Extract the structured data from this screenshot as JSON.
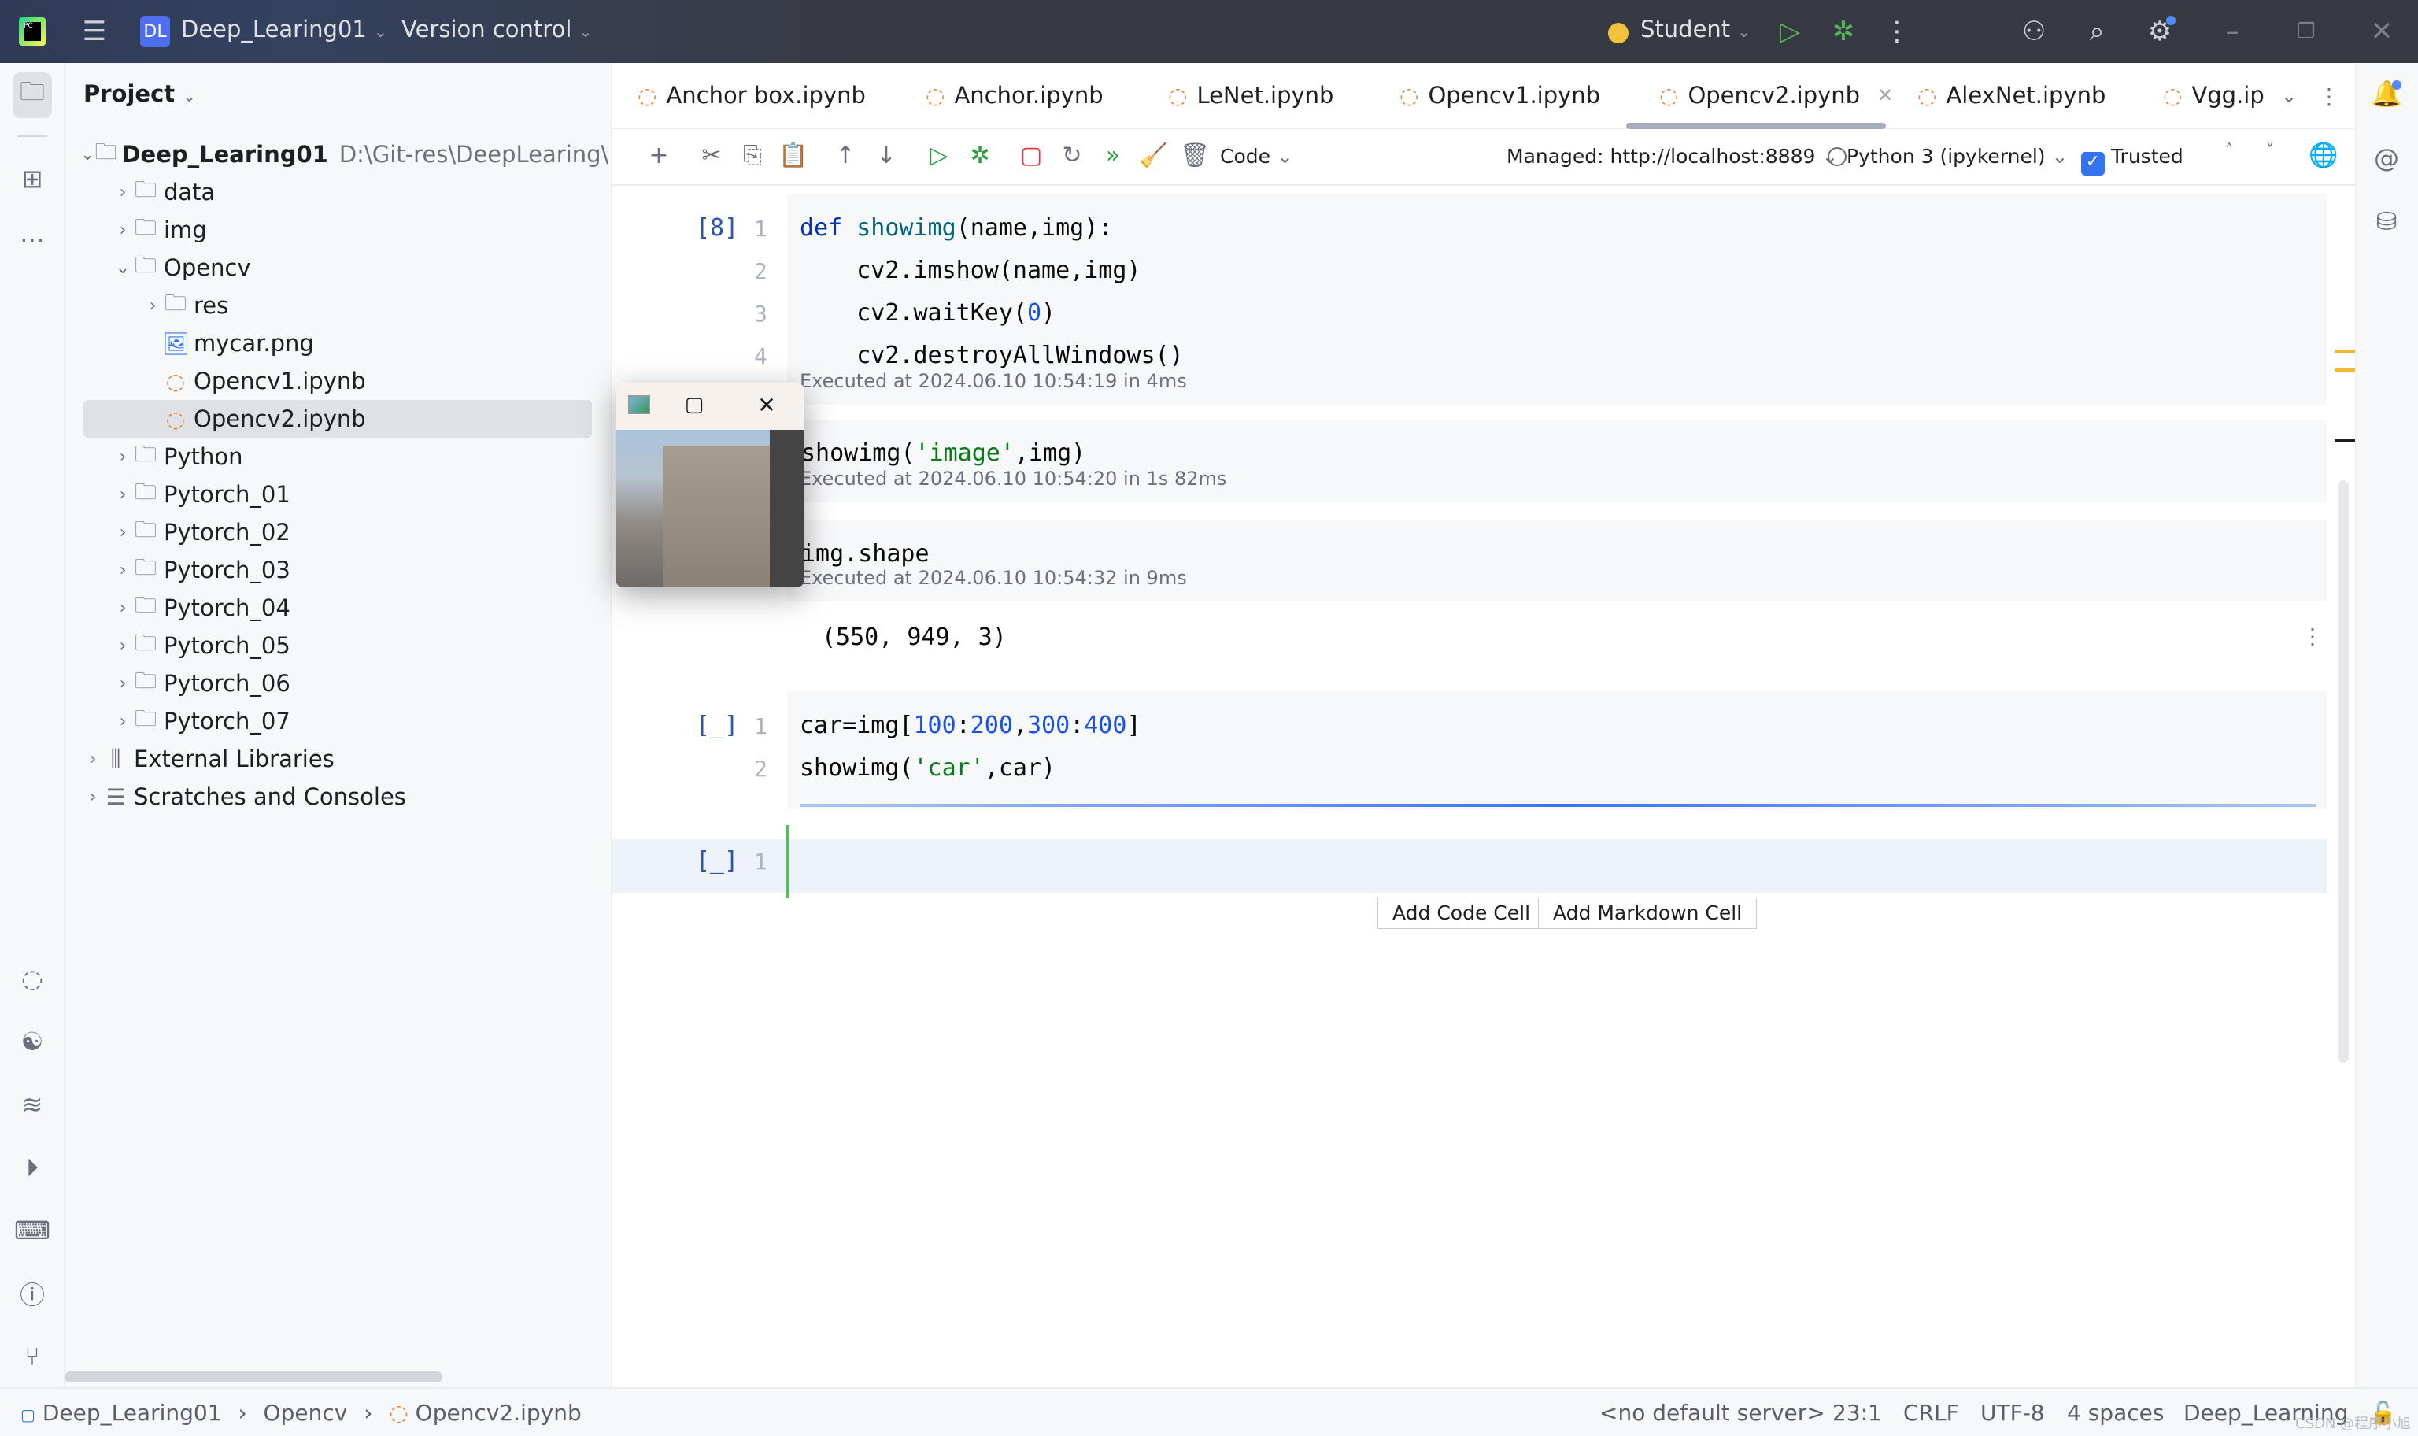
{
  "titlebar": {
    "project_badge": "DL",
    "project_name": "Deep_Learing01",
    "version_control": "Version control",
    "run_config": "Student"
  },
  "project_panel": {
    "title": "Project",
    "root": {
      "label": "Deep_Learing01",
      "path": "D:\\Git-res\\DeepLearing\\DL"
    },
    "items": [
      {
        "label": "data",
        "level": 1,
        "type": "folder",
        "expanded": false
      },
      {
        "label": "img",
        "level": 1,
        "type": "folder",
        "expanded": false
      },
      {
        "label": "Opencv",
        "level": 1,
        "type": "folder",
        "expanded": true
      },
      {
        "label": "res",
        "level": 2,
        "type": "folder",
        "expanded": false
      },
      {
        "label": "mycar.png",
        "level": 2,
        "type": "image"
      },
      {
        "label": "Opencv1.ipynb",
        "level": 2,
        "type": "notebook"
      },
      {
        "label": "Opencv2.ipynb",
        "level": 2,
        "type": "notebook",
        "selected": true
      },
      {
        "label": "Python",
        "level": 1,
        "type": "folder",
        "expanded": false
      },
      {
        "label": "Pytorch_01",
        "level": 1,
        "type": "folder",
        "expanded": false
      },
      {
        "label": "Pytorch_02",
        "level": 1,
        "type": "folder",
        "expanded": false
      },
      {
        "label": "Pytorch_03",
        "level": 1,
        "type": "folder",
        "expanded": false
      },
      {
        "label": "Pytorch_04",
        "level": 1,
        "type": "folder",
        "expanded": false
      },
      {
        "label": "Pytorch_05",
        "level": 1,
        "type": "folder",
        "expanded": false
      },
      {
        "label": "Pytorch_06",
        "level": 1,
        "type": "folder",
        "expanded": false
      },
      {
        "label": "Pytorch_07",
        "level": 1,
        "type": "folder",
        "expanded": false
      },
      {
        "label": "External Libraries",
        "level": 0,
        "type": "library",
        "expanded": false
      },
      {
        "label": "Scratches and Consoles",
        "level": 0,
        "type": "scratch",
        "expanded": false
      }
    ]
  },
  "tabs": [
    {
      "label": "Anchor box.ipynb"
    },
    {
      "label": "Anchor.ipynb"
    },
    {
      "label": "LeNet.ipynb"
    },
    {
      "label": "Opencv1.ipynb"
    },
    {
      "label": "Opencv2.ipynb",
      "active": true
    },
    {
      "label": "AlexNet.ipynb"
    },
    {
      "label": "Vgg.ip"
    }
  ],
  "toolbar": {
    "cell_type": "Code",
    "server": "Managed: http://localhost:8889",
    "kernel": "Python 3 (ipykernel)",
    "trusted_label": "Trusted",
    "trusted": true
  },
  "inspections": {
    "warnings": "2",
    "weak_warnings": "1"
  },
  "cells": [
    {
      "count": "[8]",
      "lines": [
        [
          {
            "t": "def ",
            "c": "kw"
          },
          {
            "t": "showimg",
            "c": "fn"
          },
          {
            "t": "(name,img):"
          }
        ],
        [
          {
            "t": "    cv2.imshow(name,img)"
          }
        ],
        [
          {
            "t": "    cv2.waitKey("
          },
          {
            "t": "0",
            "c": "num"
          },
          {
            "t": ")"
          }
        ],
        [
          {
            "t": "    cv2.destroyAllWindows()"
          }
        ]
      ],
      "executed": "Executed at 2024.06.10 10:54:19 in 4ms"
    },
    {
      "lines": [
        [
          {
            "t": "showimg("
          },
          {
            "t": "'image'",
            "c": "str"
          },
          {
            "t": ",img)"
          }
        ]
      ],
      "executed": "Executed at 2024.06.10 10:54:20 in 1s 82ms"
    },
    {
      "lines": [
        [
          {
            "t": "img.shape"
          }
        ]
      ],
      "executed": "Executed at 2024.06.10 10:54:32 in 9ms",
      "output": "(550, 949, 3)"
    },
    {
      "count": "[_]",
      "lines": [
        [
          {
            "t": "car=img["
          },
          {
            "t": "100",
            "c": "num"
          },
          {
            "t": ":"
          },
          {
            "t": "200",
            "c": "num"
          },
          {
            "t": ","
          },
          {
            "t": "300",
            "c": "num"
          },
          {
            "t": ":"
          },
          {
            "t": "400",
            "c": "num"
          },
          {
            "t": "]"
          }
        ],
        [
          {
            "t": "showimg("
          },
          {
            "t": "'car'",
            "c": "str"
          },
          {
            "t": ",car)"
          }
        ]
      ],
      "running": true
    },
    {
      "count": "[_]",
      "lines": [
        [
          {
            "t": ""
          }
        ]
      ],
      "active": true
    }
  ],
  "add_buttons": {
    "code": "Add Code Cell",
    "markdown": "Add Markdown Cell"
  },
  "statusbar": {
    "breadcrumb": [
      "Deep_Learing01",
      "Opencv",
      "Opencv2.ipynb"
    ],
    "server": "<no default server>",
    "position": "23:1",
    "line_ending": "CRLF",
    "encoding": "UTF-8",
    "indent": "4 spaces",
    "interpreter": "Deep_Learning",
    "watermark": "CSDN @程序小旭"
  },
  "colors": {
    "accent": "#3574f0",
    "notebook_icon": "#e8833a",
    "run_green": "#2e9e3e",
    "stop_red": "#db3b4b"
  }
}
